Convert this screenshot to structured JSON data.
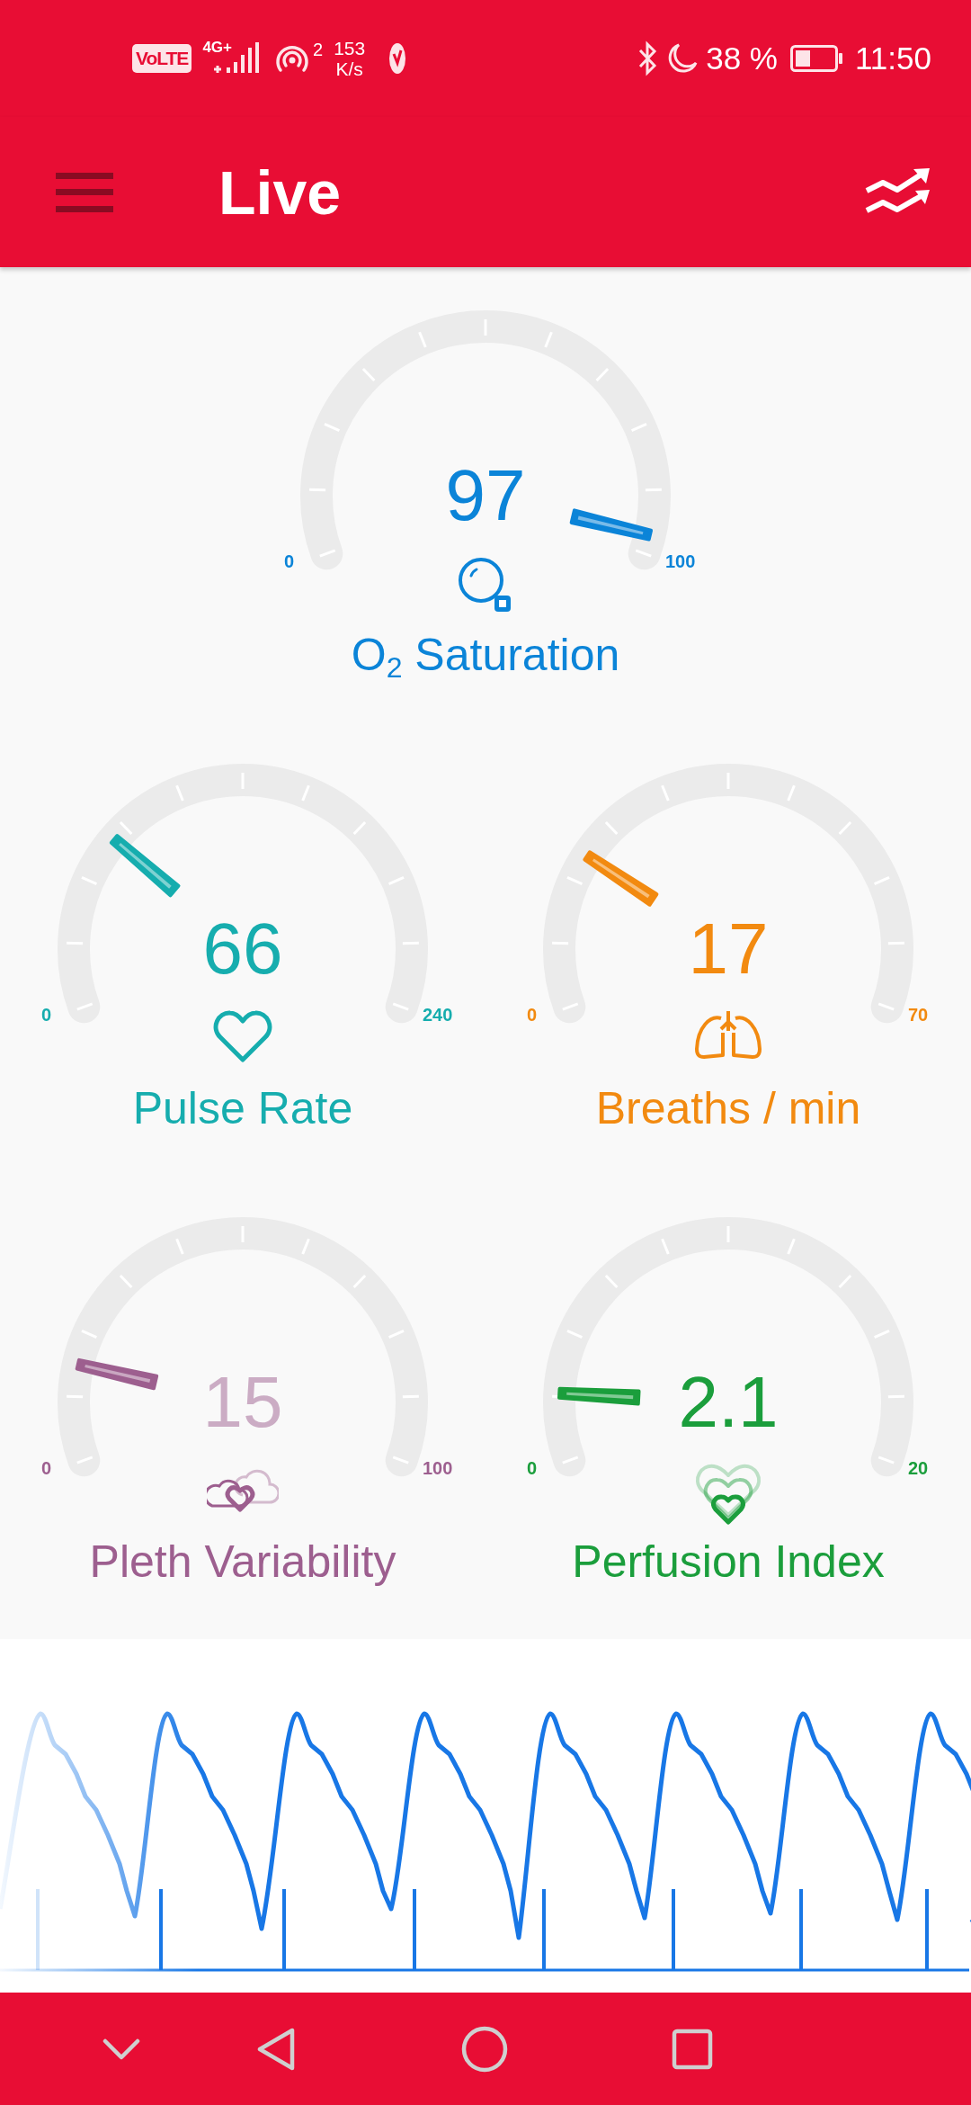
{
  "status_bar": {
    "volte": "VoLTE",
    "network": "4G+",
    "hotspot_count": "2",
    "speed": "153",
    "speed_unit": "K/s",
    "battery": "38 %",
    "time": "11:50"
  },
  "app_bar": {
    "title": "Live"
  },
  "gauges": [
    {
      "kind": "oxygen",
      "value": "97",
      "min": "0",
      "max": "100",
      "label": "O$_{2}$ Saturation",
      "color": "#0b84d8",
      "dimmed": false
    },
    {
      "kind": "heart",
      "value": "66",
      "min": "0",
      "max": "240",
      "label": "Pulse Rate",
      "color": "#16adae",
      "dimmed": false
    },
    {
      "kind": "lungs",
      "value": "17",
      "min": "0",
      "max": "70",
      "label": "Breaths / min",
      "color": "#f28a10",
      "dimmed": false
    },
    {
      "kind": "pleth",
      "value": "15",
      "min": "0",
      "max": "100",
      "label": "Pleth Variability",
      "color": "#9d5f8f",
      "dimmed": true
    },
    {
      "kind": "perfusion",
      "value": "2.1",
      "min": "0",
      "max": "20",
      "label": "Perfusion Index",
      "color": "#1b9e3c",
      "dimmed": false
    }
  ]
}
